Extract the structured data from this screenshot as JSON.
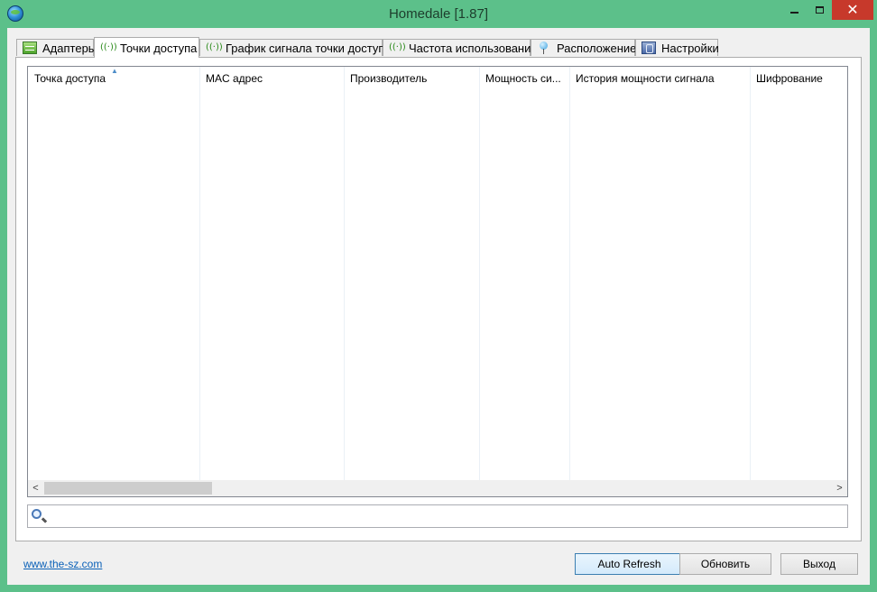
{
  "window": {
    "title": "Homedale [1.87]",
    "close_glyph": "✕"
  },
  "tabs": [
    {
      "label": "Адаптеры",
      "icon": "network-adapter-icon"
    },
    {
      "label": "Точки доступа",
      "icon": "antenna-icon",
      "active": true
    },
    {
      "label": "График сигнала точки доступа",
      "icon": "antenna-icon"
    },
    {
      "label": "Частота использования",
      "icon": "antenna-icon"
    },
    {
      "label": "Расположение",
      "icon": "map-pin-icon"
    },
    {
      "label": "Настройки",
      "icon": "settings-icon"
    }
  ],
  "antenna_glyph": "((·))",
  "table": {
    "columns": [
      "Точка доступа",
      "MAC адрес",
      "Производитель",
      "Мощность си...",
      "История мощности сигнала",
      "Шифрование"
    ],
    "sort_indicator": "▲",
    "rows": []
  },
  "scrollbar": {
    "left_glyph": "<",
    "right_glyph": ">"
  },
  "search": {
    "value": "",
    "placeholder": ""
  },
  "footer": {
    "link": "www.the-sz.com",
    "auto_refresh": "Auto Refresh",
    "refresh": "Обновить",
    "exit": "Выход"
  }
}
